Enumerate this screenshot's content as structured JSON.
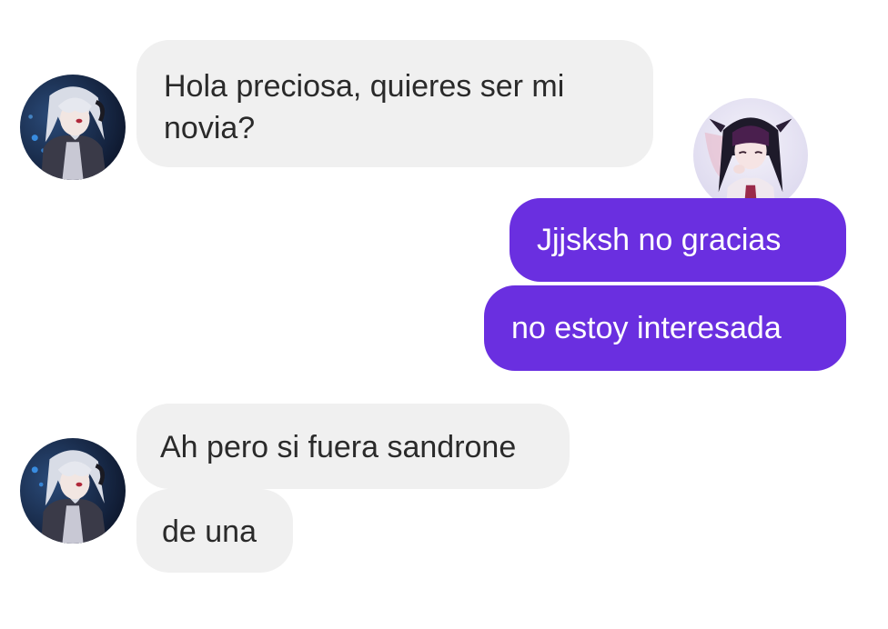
{
  "conversation": {
    "messages": [
      {
        "sender": "incoming",
        "text": "Hola preciosa, quieres ser mi novia?"
      },
      {
        "sender": "outgoing",
        "text": "Jjjsksh no gracias"
      },
      {
        "sender": "outgoing",
        "text": "no estoy interesada"
      },
      {
        "sender": "incoming",
        "text": "Ah pero si fuera sandrone"
      },
      {
        "sender": "incoming",
        "text": "de una"
      }
    ]
  },
  "colors": {
    "incoming_bubble": "#f0f0f0",
    "outgoing_bubble": "#6a2fe0",
    "incoming_text": "#2a2a2a",
    "outgoing_text": "#ffffff"
  }
}
